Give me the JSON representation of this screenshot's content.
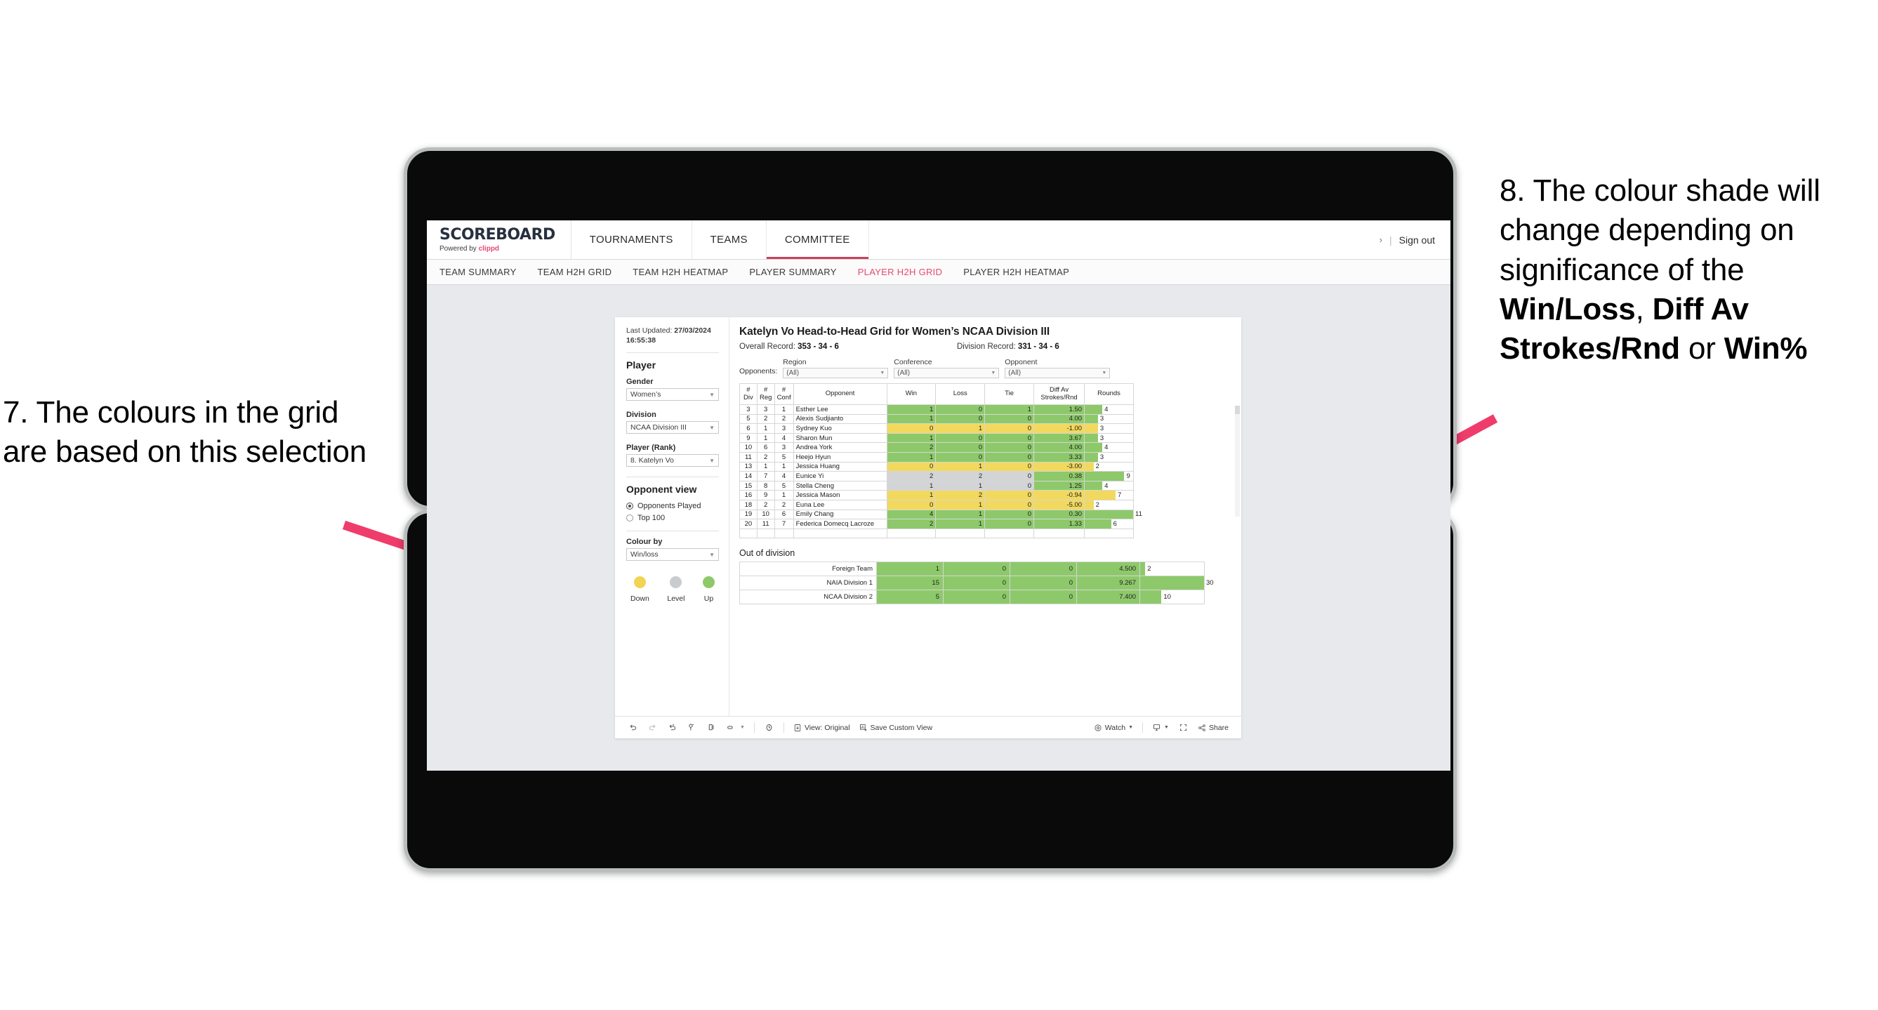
{
  "annotations": {
    "left": "7. The colours in the grid are based on this selection",
    "right_parts": [
      {
        "text": "8. The colour shade will change depending on significance of the ",
        "bold": false
      },
      {
        "text": "Win/Loss",
        "bold": true
      },
      {
        "text": ", ",
        "bold": false
      },
      {
        "text": "Diff Av Strokes/Rnd",
        "bold": true
      },
      {
        "text": " or ",
        "bold": false
      },
      {
        "text": "Win%",
        "bold": true
      }
    ],
    "arrow_color": "#ef3d6b"
  },
  "brand": {
    "name": "SCOREBOARD",
    "powered_by": "Powered by ",
    "powered_brand": "clippd"
  },
  "topnav": [
    {
      "label": "TOURNAMENTS",
      "active": false
    },
    {
      "label": "TEAMS",
      "active": false
    },
    {
      "label": "COMMITTEE",
      "active": true
    }
  ],
  "topbar_right": {
    "chevron": "›",
    "divider": "|",
    "signout": "Sign out"
  },
  "subnav": [
    {
      "label": "TEAM SUMMARY",
      "active": false
    },
    {
      "label": "TEAM H2H GRID",
      "active": false
    },
    {
      "label": "TEAM H2H HEATMAP",
      "active": false
    },
    {
      "label": "PLAYER SUMMARY",
      "active": false
    },
    {
      "label": "PLAYER H2H GRID",
      "active": true
    },
    {
      "label": "PLAYER H2H HEATMAP",
      "active": false
    }
  ],
  "sidebar": {
    "last_updated_label": "Last Updated: ",
    "last_updated_value": "27/03/2024 16:55:38",
    "section_player": "Player",
    "gender": {
      "label": "Gender",
      "value": "Women’s"
    },
    "division": {
      "label": "Division",
      "value": "NCAA Division III"
    },
    "player_rank": {
      "label": "Player (Rank)",
      "value": "8. Katelyn Vo"
    },
    "opponent_view": {
      "heading": "Opponent view",
      "options": [
        {
          "label": "Opponents Played",
          "selected": true
        },
        {
          "label": "Top 100",
          "selected": false
        }
      ]
    },
    "colour_by": {
      "label": "Colour by",
      "value": "Win/loss"
    },
    "legend": [
      {
        "label": "Down",
        "color": "#f2d454"
      },
      {
        "label": "Level",
        "color": "#c9cccf"
      },
      {
        "label": "Up",
        "color": "#8dc96a"
      }
    ]
  },
  "main": {
    "title": "Katelyn Vo Head-to-Head Grid for Women’s NCAA Division III",
    "overall_record_label": "Overall Record: ",
    "overall_record_value": "353 -  34 - 6",
    "division_record_label": "Division Record: ",
    "division_record_value": "331 -  34 - 6",
    "opponents_label": "Opponents:",
    "filters": [
      {
        "label": "Region",
        "value": "(All)"
      },
      {
        "label": "Conference",
        "value": "(All)"
      },
      {
        "label": "Opponent",
        "value": "(All)"
      }
    ],
    "out_of_division_title": "Out of division"
  },
  "chart_data": {
    "type": "table",
    "title": "Katelyn Vo Head-to-Head Grid for Women’s NCAA Division III",
    "columns": [
      "# Div",
      "# Reg",
      "# Conf",
      "Opponent",
      "Win",
      "Loss",
      "Tie",
      "Diff Av Strokes/Rnd",
      "Rounds"
    ],
    "column_headers_two_line": [
      {
        "l1": "#",
        "l2": "Div"
      },
      {
        "l1": "#",
        "l2": "Reg"
      },
      {
        "l1": "#",
        "l2": "Conf"
      },
      {
        "l1": "Opponent",
        "l2": ""
      },
      {
        "l1": "Win",
        "l2": ""
      },
      {
        "l1": "Loss",
        "l2": ""
      },
      {
        "l1": "Tie",
        "l2": ""
      },
      {
        "l1": "Diff Av",
        "l2": "Strokes/Rnd"
      },
      {
        "l1": "Rounds",
        "l2": ""
      }
    ],
    "rows_max_rounds": 11,
    "rows": [
      {
        "div": "3",
        "reg": "3",
        "conf": "1",
        "opponent": "Esther Lee",
        "win": "1",
        "loss": "0",
        "tie": "1",
        "diff": "1.50",
        "rounds": "4",
        "color": "green"
      },
      {
        "div": "5",
        "reg": "2",
        "conf": "2",
        "opponent": "Alexis Sudjianto",
        "win": "1",
        "loss": "0",
        "tie": "0",
        "diff": "4.00",
        "rounds": "3",
        "color": "green"
      },
      {
        "div": "6",
        "reg": "1",
        "conf": "3",
        "opponent": "Sydney Kuo",
        "win": "0",
        "loss": "1",
        "tie": "0",
        "diff": "-1.00",
        "rounds": "3",
        "color": "yellow"
      },
      {
        "div": "9",
        "reg": "1",
        "conf": "4",
        "opponent": "Sharon Mun",
        "win": "1",
        "loss": "0",
        "tie": "0",
        "diff": "3.67",
        "rounds": "3",
        "color": "green"
      },
      {
        "div": "10",
        "reg": "6",
        "conf": "3",
        "opponent": "Andrea York",
        "win": "2",
        "loss": "0",
        "tie": "0",
        "diff": "4.00",
        "rounds": "4",
        "color": "green"
      },
      {
        "div": "11",
        "reg": "2",
        "conf": "5",
        "opponent": "Heejo Hyun",
        "win": "1",
        "loss": "0",
        "tie": "0",
        "diff": "3.33",
        "rounds": "3",
        "color": "green"
      },
      {
        "div": "13",
        "reg": "1",
        "conf": "1",
        "opponent": "Jessica Huang",
        "win": "0",
        "loss": "1",
        "tie": "0",
        "diff": "-3.00",
        "rounds": "2",
        "color": "yellow"
      },
      {
        "div": "14",
        "reg": "7",
        "conf": "4",
        "opponent": "Eunice Yi",
        "win": "2",
        "loss": "2",
        "tie": "0",
        "diff": "0.38",
        "rounds": "9",
        "color": "grey",
        "diff_color": "green"
      },
      {
        "div": "15",
        "reg": "8",
        "conf": "5",
        "opponent": "Stella Cheng",
        "win": "1",
        "loss": "1",
        "tie": "0",
        "diff": "1.25",
        "rounds": "4",
        "color": "grey",
        "diff_color": "green"
      },
      {
        "div": "16",
        "reg": "9",
        "conf": "1",
        "opponent": "Jessica Mason",
        "win": "1",
        "loss": "2",
        "tie": "0",
        "diff": "-0.94",
        "rounds": "7",
        "color": "yellow"
      },
      {
        "div": "18",
        "reg": "2",
        "conf": "2",
        "opponent": "Euna Lee",
        "win": "0",
        "loss": "1",
        "tie": "0",
        "diff": "-5.00",
        "rounds": "2",
        "color": "yellow"
      },
      {
        "div": "19",
        "reg": "10",
        "conf": "6",
        "opponent": "Emily Chang",
        "win": "4",
        "loss": "1",
        "tie": "0",
        "diff": "0.30",
        "rounds": "11",
        "color": "green"
      },
      {
        "div": "20",
        "reg": "11",
        "conf": "7",
        "opponent": "Federica Domecq Lacroze",
        "win": "2",
        "loss": "1",
        "tie": "0",
        "diff": "1.33",
        "rounds": "6",
        "color": "green"
      }
    ],
    "out_of_division": {
      "max_rounds": 30,
      "rows": [
        {
          "label": "Foreign Team",
          "win": "1",
          "loss": "0",
          "tie": "0",
          "diff": "4.500",
          "rounds": "2",
          "color": "green"
        },
        {
          "label": "NAIA Division 1",
          "win": "15",
          "loss": "0",
          "tie": "0",
          "diff": "9.267",
          "rounds": "30",
          "color": "green"
        },
        {
          "label": "NCAA Division 2",
          "win": "5",
          "loss": "0",
          "tie": "0",
          "diff": "7.400",
          "rounds": "10",
          "color": "green"
        }
      ]
    },
    "colors": {
      "green": "#8dc96a",
      "yellow": "#f2d95e",
      "grey": "#d2d4d6"
    }
  },
  "toolbar": {
    "icons": [
      "undo-icon",
      "redo-icon",
      "revert-icon",
      "refresh-icon",
      "pause-icon",
      "highlight-icon"
    ],
    "view_label": "View: Original",
    "save_label": "Save Custom View",
    "watch_label": "Watch",
    "share_label": "Share"
  }
}
